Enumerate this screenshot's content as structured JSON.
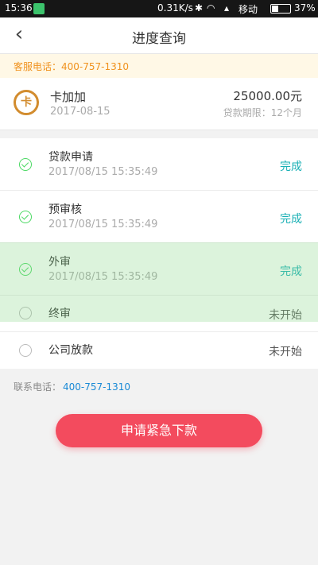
{
  "status_bar": {
    "time": "15:36",
    "net_speed": "0.31K/s",
    "carrier": "移动",
    "battery": "37%"
  },
  "nav": {
    "title": "进度查询",
    "back_glyph": "‹"
  },
  "hotline": {
    "text": "客服电话：400-757-1310"
  },
  "product": {
    "logo_char": "卡",
    "name": "卡加加",
    "date": "2017-08-15",
    "amount": "25000.00元",
    "term": "贷款期限：12个月"
  },
  "steps": [
    {
      "name": "贷款申请",
      "time": "2017/08/15 15:35:49",
      "state": "完成"
    },
    {
      "name": "预审核",
      "time": "2017/08/15 15:35:49",
      "state": "完成"
    },
    {
      "name": "外审",
      "time": "2017/08/15 15:35:49",
      "state": "完成"
    },
    {
      "name": "终审",
      "time": "",
      "state": "未开始"
    },
    {
      "name": "公司放款",
      "time": "",
      "state": "未开始"
    }
  ],
  "contact": {
    "label": "联系电话：",
    "phone": "400-757-1310"
  },
  "action": {
    "urgent_label": "申请紧急下款"
  },
  "colors": {
    "accent_red": "#f34b5e",
    "done_teal": "#1ab0b5",
    "hotline_orange": "#f0921e",
    "check_green": "#4cd964"
  }
}
